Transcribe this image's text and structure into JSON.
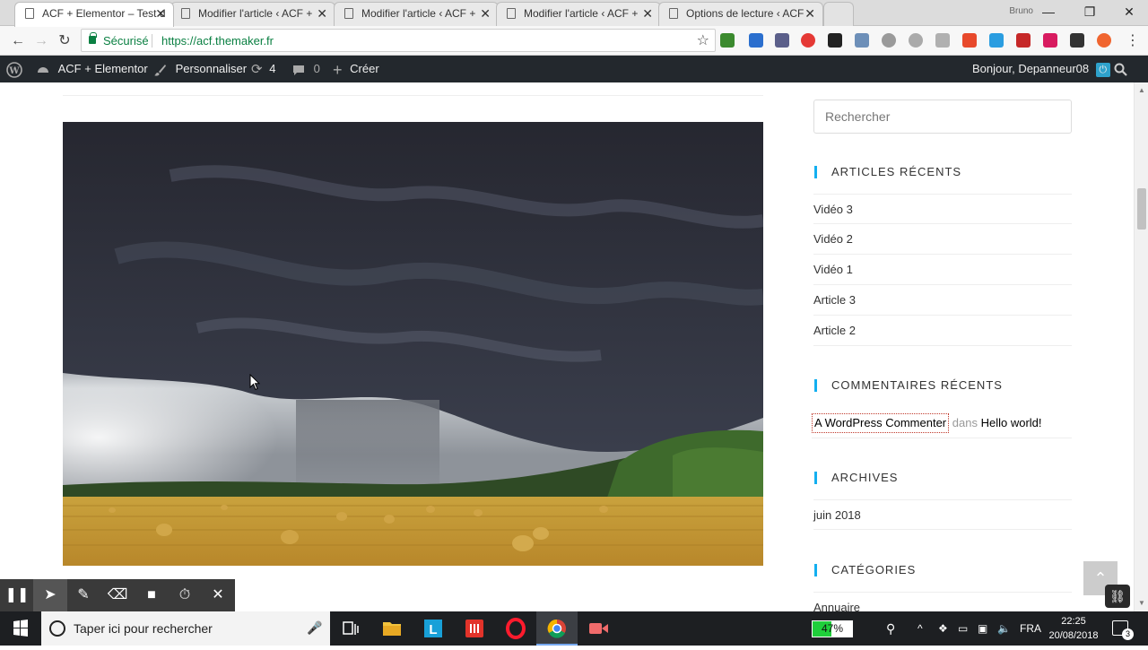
{
  "browser": {
    "tabs": [
      {
        "title": "ACF + Elementor – Test d",
        "active": true
      },
      {
        "title": "Modifier l'article ‹ ACF +",
        "active": false
      },
      {
        "title": "Modifier l'article ‹ ACF +",
        "active": false
      },
      {
        "title": "Modifier l'article ‹ ACF +",
        "active": false
      },
      {
        "title": "Options de lecture ‹ ACF",
        "active": false
      }
    ],
    "profile": "Bruno",
    "secure_label": "Sécurisé",
    "url": "https://acf.themaker.fr"
  },
  "adminbar": {
    "site_name": "ACF + Elementor",
    "customize": "Personnaliser",
    "updates_count": "4",
    "comments_count": "0",
    "new_label": "Créer",
    "greeting": "Bonjour, Depanneur08"
  },
  "sidebar": {
    "search_placeholder": "Rechercher",
    "recent_posts_title": "ARTICLES RÉCENTS",
    "recent_posts": [
      "Vidéo 3",
      "Vidéo 2",
      "Vidéo 1",
      "Article 3",
      "Article 2"
    ],
    "recent_comments_title": "COMMENTAIRES RÉCENTS",
    "comment_author": "A WordPress Commenter",
    "comment_connector": "dans",
    "comment_post": "Hello world!",
    "archives_title": "ARCHIVES",
    "archives": [
      "juin 2018"
    ],
    "categories_title": "CATÉGORIES",
    "categories": [
      "Annuaire"
    ]
  },
  "taskbar": {
    "search_placeholder": "Taper ici pour rechercher",
    "battery_percent": "47%",
    "battery_level": 0.47,
    "language": "FRA",
    "time": "22:25",
    "date": "20/08/2018",
    "notification_count": "3"
  },
  "colors": {
    "wp_bar": "#23282d",
    "accent": "#13aff0",
    "secure_green": "#0b8043"
  }
}
